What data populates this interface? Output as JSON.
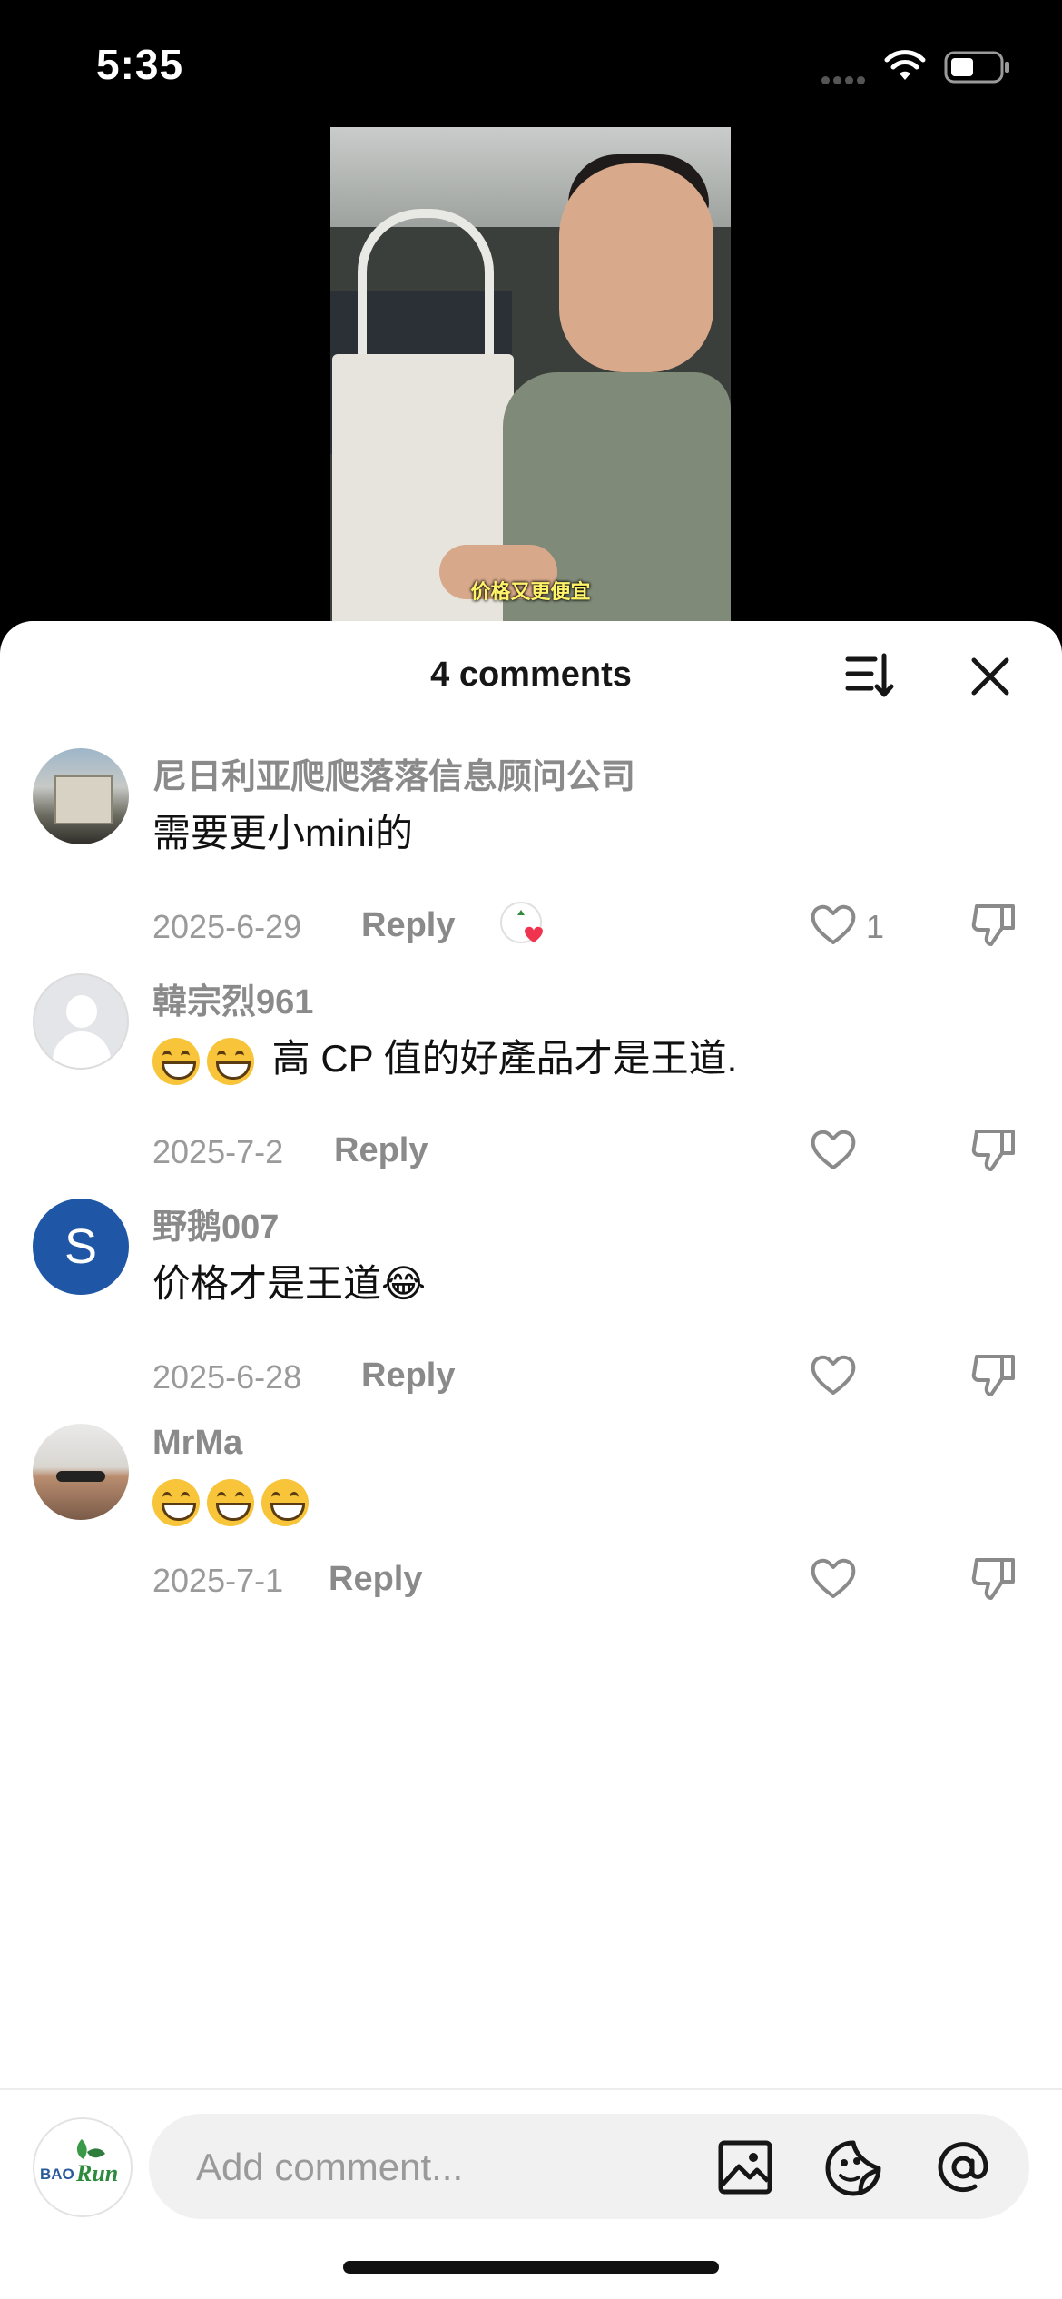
{
  "status_bar": {
    "time": "5:35"
  },
  "video": {
    "caption": "价格又更便宜"
  },
  "sheet": {
    "title": "4 comments"
  },
  "comments": [
    {
      "username": "尼日利亚爬爬落落信息顾问公司",
      "text": "需要更小mini的",
      "date": "2025-6-29",
      "reply_label": "Reply",
      "likes": "1",
      "creator_liked": true
    },
    {
      "username": "韓宗烈961",
      "text": "高 CP 值的好產品才是王道.",
      "emojis_before": 2,
      "date": "2025-7-2",
      "reply_label": "Reply",
      "likes": ""
    },
    {
      "username": "野鹅007",
      "text": "价格才是王道😂",
      "avatar_letter": "S",
      "avatar_color": "#1f57a6",
      "date": "2025-6-28",
      "reply_label": "Reply",
      "likes": ""
    },
    {
      "username": "MrMa",
      "text": "😁😁😁",
      "date": "2025-7-1",
      "reply_label": "Reply",
      "likes": ""
    }
  ],
  "composer": {
    "placeholder": "Add comment...",
    "avatar_logo": "BAORUN"
  },
  "icons": {
    "sort": "sort-icon",
    "close": "close-icon",
    "like": "heart-icon",
    "dislike": "thumbs-down-icon",
    "image": "image-icon",
    "sticker": "sticker-icon",
    "mention": "at-icon"
  }
}
